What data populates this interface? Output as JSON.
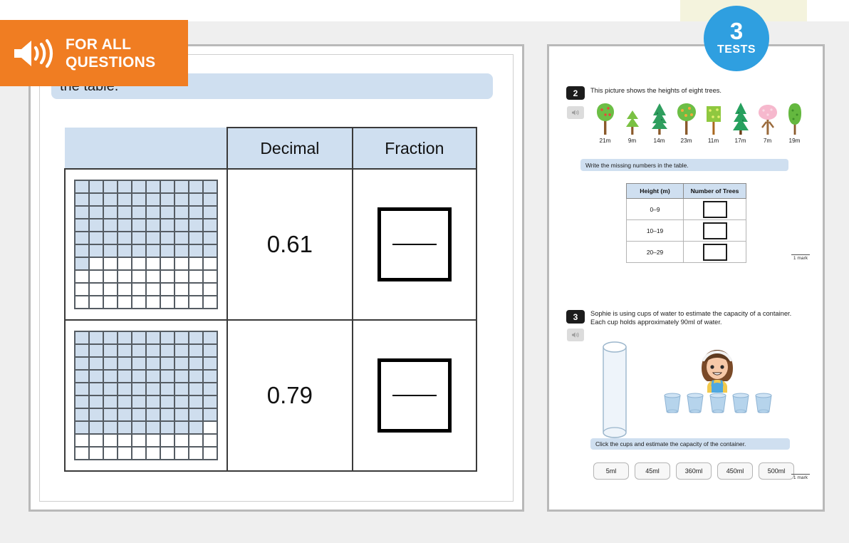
{
  "badges": {
    "audio": {
      "line1": "FOR ALL",
      "line2": "QUESTIONS",
      "icon": "speaker-icon",
      "color": "#f07d22"
    },
    "tests": {
      "number": "3",
      "label": "TESTS",
      "color": "#2f9fe0"
    }
  },
  "left_page": {
    "instruction": "the table.",
    "table": {
      "headers": [
        "Decimal",
        "Fraction"
      ],
      "rows": [
        {
          "shaded": 61,
          "decimal": "0.61",
          "fraction": ""
        },
        {
          "shaded": 79,
          "decimal": "0.79",
          "fraction": ""
        }
      ]
    }
  },
  "right_page": {
    "questions": [
      {
        "number": "2",
        "prompt": "This picture shows the heights of eight trees.",
        "trees": [
          {
            "label": "21m",
            "kind": "round-red"
          },
          {
            "label": "9m",
            "kind": "fir-small"
          },
          {
            "label": "14m",
            "kind": "fir-tall"
          },
          {
            "label": "23m",
            "kind": "round-orange"
          },
          {
            "label": "11m",
            "kind": "bush-yellow"
          },
          {
            "label": "17m",
            "kind": "fir-dark"
          },
          {
            "label": "7m",
            "kind": "blossom-pink"
          },
          {
            "label": "19m",
            "kind": "column-green"
          }
        ],
        "sub_instruction": "Write the missing numbers in the table.",
        "table": {
          "headers": [
            "Height (m)",
            "Number of Trees"
          ],
          "rows": [
            {
              "range": "0–9",
              "count": ""
            },
            {
              "range": "10–19",
              "count": ""
            },
            {
              "range": "20–29",
              "count": ""
            }
          ]
        },
        "mark": "1 mark"
      },
      {
        "number": "3",
        "prompt_line1": "Sophie is using cups of water to estimate the capacity of a container.",
        "prompt_line2": "Each cup holds approximately 90ml of water.",
        "cups_count": 5,
        "sub_instruction": "Click the cups and estimate the capacity of the container.",
        "options": [
          "5ml",
          "45ml",
          "360ml",
          "450ml",
          "500ml"
        ],
        "mark": "1 mark"
      }
    ]
  }
}
